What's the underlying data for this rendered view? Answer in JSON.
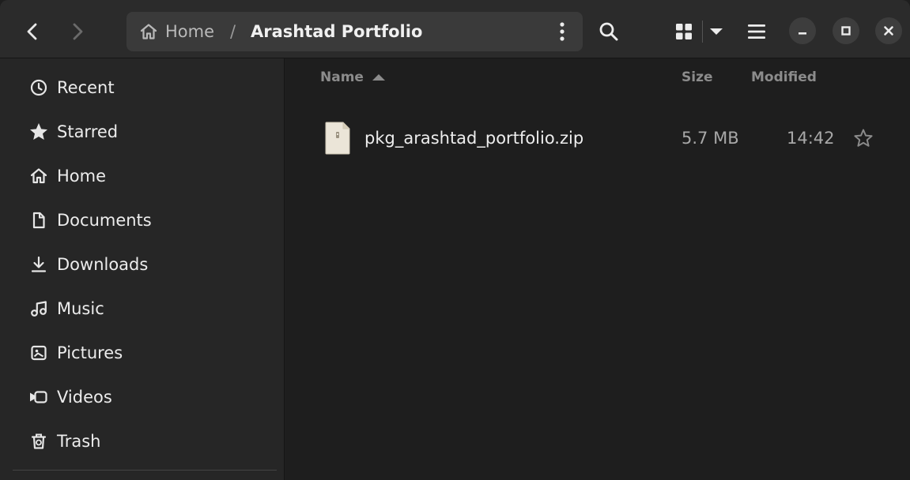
{
  "header": {
    "back_icon": "chevron-left-icon",
    "forward_icon": "chevron-right-icon",
    "path": {
      "home_label": "Home",
      "separator": "/",
      "current": "Arashtad Portfolio"
    },
    "icons": [
      "kebab-menu-icon",
      "search-icon",
      "grid-view-icon",
      "dropdown-arrow-icon",
      "hamburger-menu-icon",
      "minimize-icon",
      "maximize-icon",
      "close-icon"
    ]
  },
  "sidebar": {
    "items": [
      {
        "label": "Recent",
        "icon": "clock-icon"
      },
      {
        "label": "Starred",
        "icon": "star-icon"
      },
      {
        "label": "Home",
        "icon": "home-icon"
      },
      {
        "label": "Documents",
        "icon": "document-icon"
      },
      {
        "label": "Downloads",
        "icon": "download-icon"
      },
      {
        "label": "Music",
        "icon": "music-icon"
      },
      {
        "label": "Pictures",
        "icon": "picture-icon"
      },
      {
        "label": "Videos",
        "icon": "video-icon"
      },
      {
        "label": "Trash",
        "icon": "trash-icon"
      }
    ]
  },
  "main": {
    "columns": {
      "name": "Name",
      "size": "Size",
      "modified": "Modified"
    },
    "files": [
      {
        "name": "pkg_arashtad_portfolio.zip",
        "size": "5.7 MB",
        "modified": "14:42",
        "icon": "zip-file-icon"
      }
    ]
  }
}
